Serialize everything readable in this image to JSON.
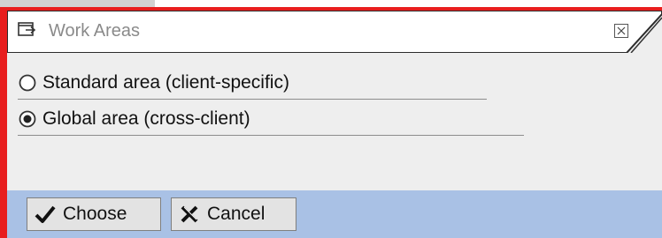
{
  "dialog": {
    "title": "Work Areas",
    "title_icon": "window-icon",
    "close_icon": "close-icon"
  },
  "options": [
    {
      "label": "Standard area (client-specific)",
      "selected": false
    },
    {
      "label": "Global area (cross-client)",
      "selected": true
    }
  ],
  "footer": {
    "choose_label": "Choose",
    "choose_icon": "checkmark-icon",
    "cancel_label": "Cancel",
    "cancel_icon": "cancel-x-icon"
  },
  "colors": {
    "highlight_border": "#e81e1e",
    "footer_bg": "#a9c1e5",
    "dialog_bg": "#eeeeee"
  }
}
